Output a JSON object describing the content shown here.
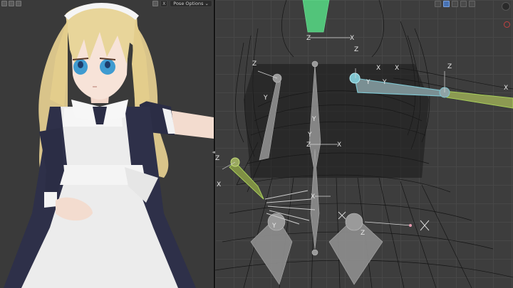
{
  "left_viewport": {
    "header": {
      "close_label": "X",
      "pose_options_label": "Pose Options"
    },
    "icons": [
      "viewport-shading-icon",
      "overlay-icon",
      "gizmo-icon"
    ]
  },
  "right_viewport": {
    "toolbar_icons": [
      "select-icon",
      "box-select-icon",
      "circle-select-icon",
      "lasso-select-icon",
      "transform-icon"
    ],
    "axis_labels": [
      "Z",
      "X",
      "Y",
      "Z",
      "X",
      "Y",
      "Z",
      "X",
      "Z",
      "Y",
      "Z",
      "X",
      "Y",
      "X",
      "Z",
      "X",
      "Y",
      "Z",
      "X",
      "Y"
    ]
  },
  "colors": {
    "bone_gray": "#8a8a8a",
    "bone_selected": "#7ec4cf",
    "bone_green": "#9bc460",
    "bone_active_green": "#52c47a",
    "wire": "#101010",
    "axis_label": "#e8e8e8"
  }
}
